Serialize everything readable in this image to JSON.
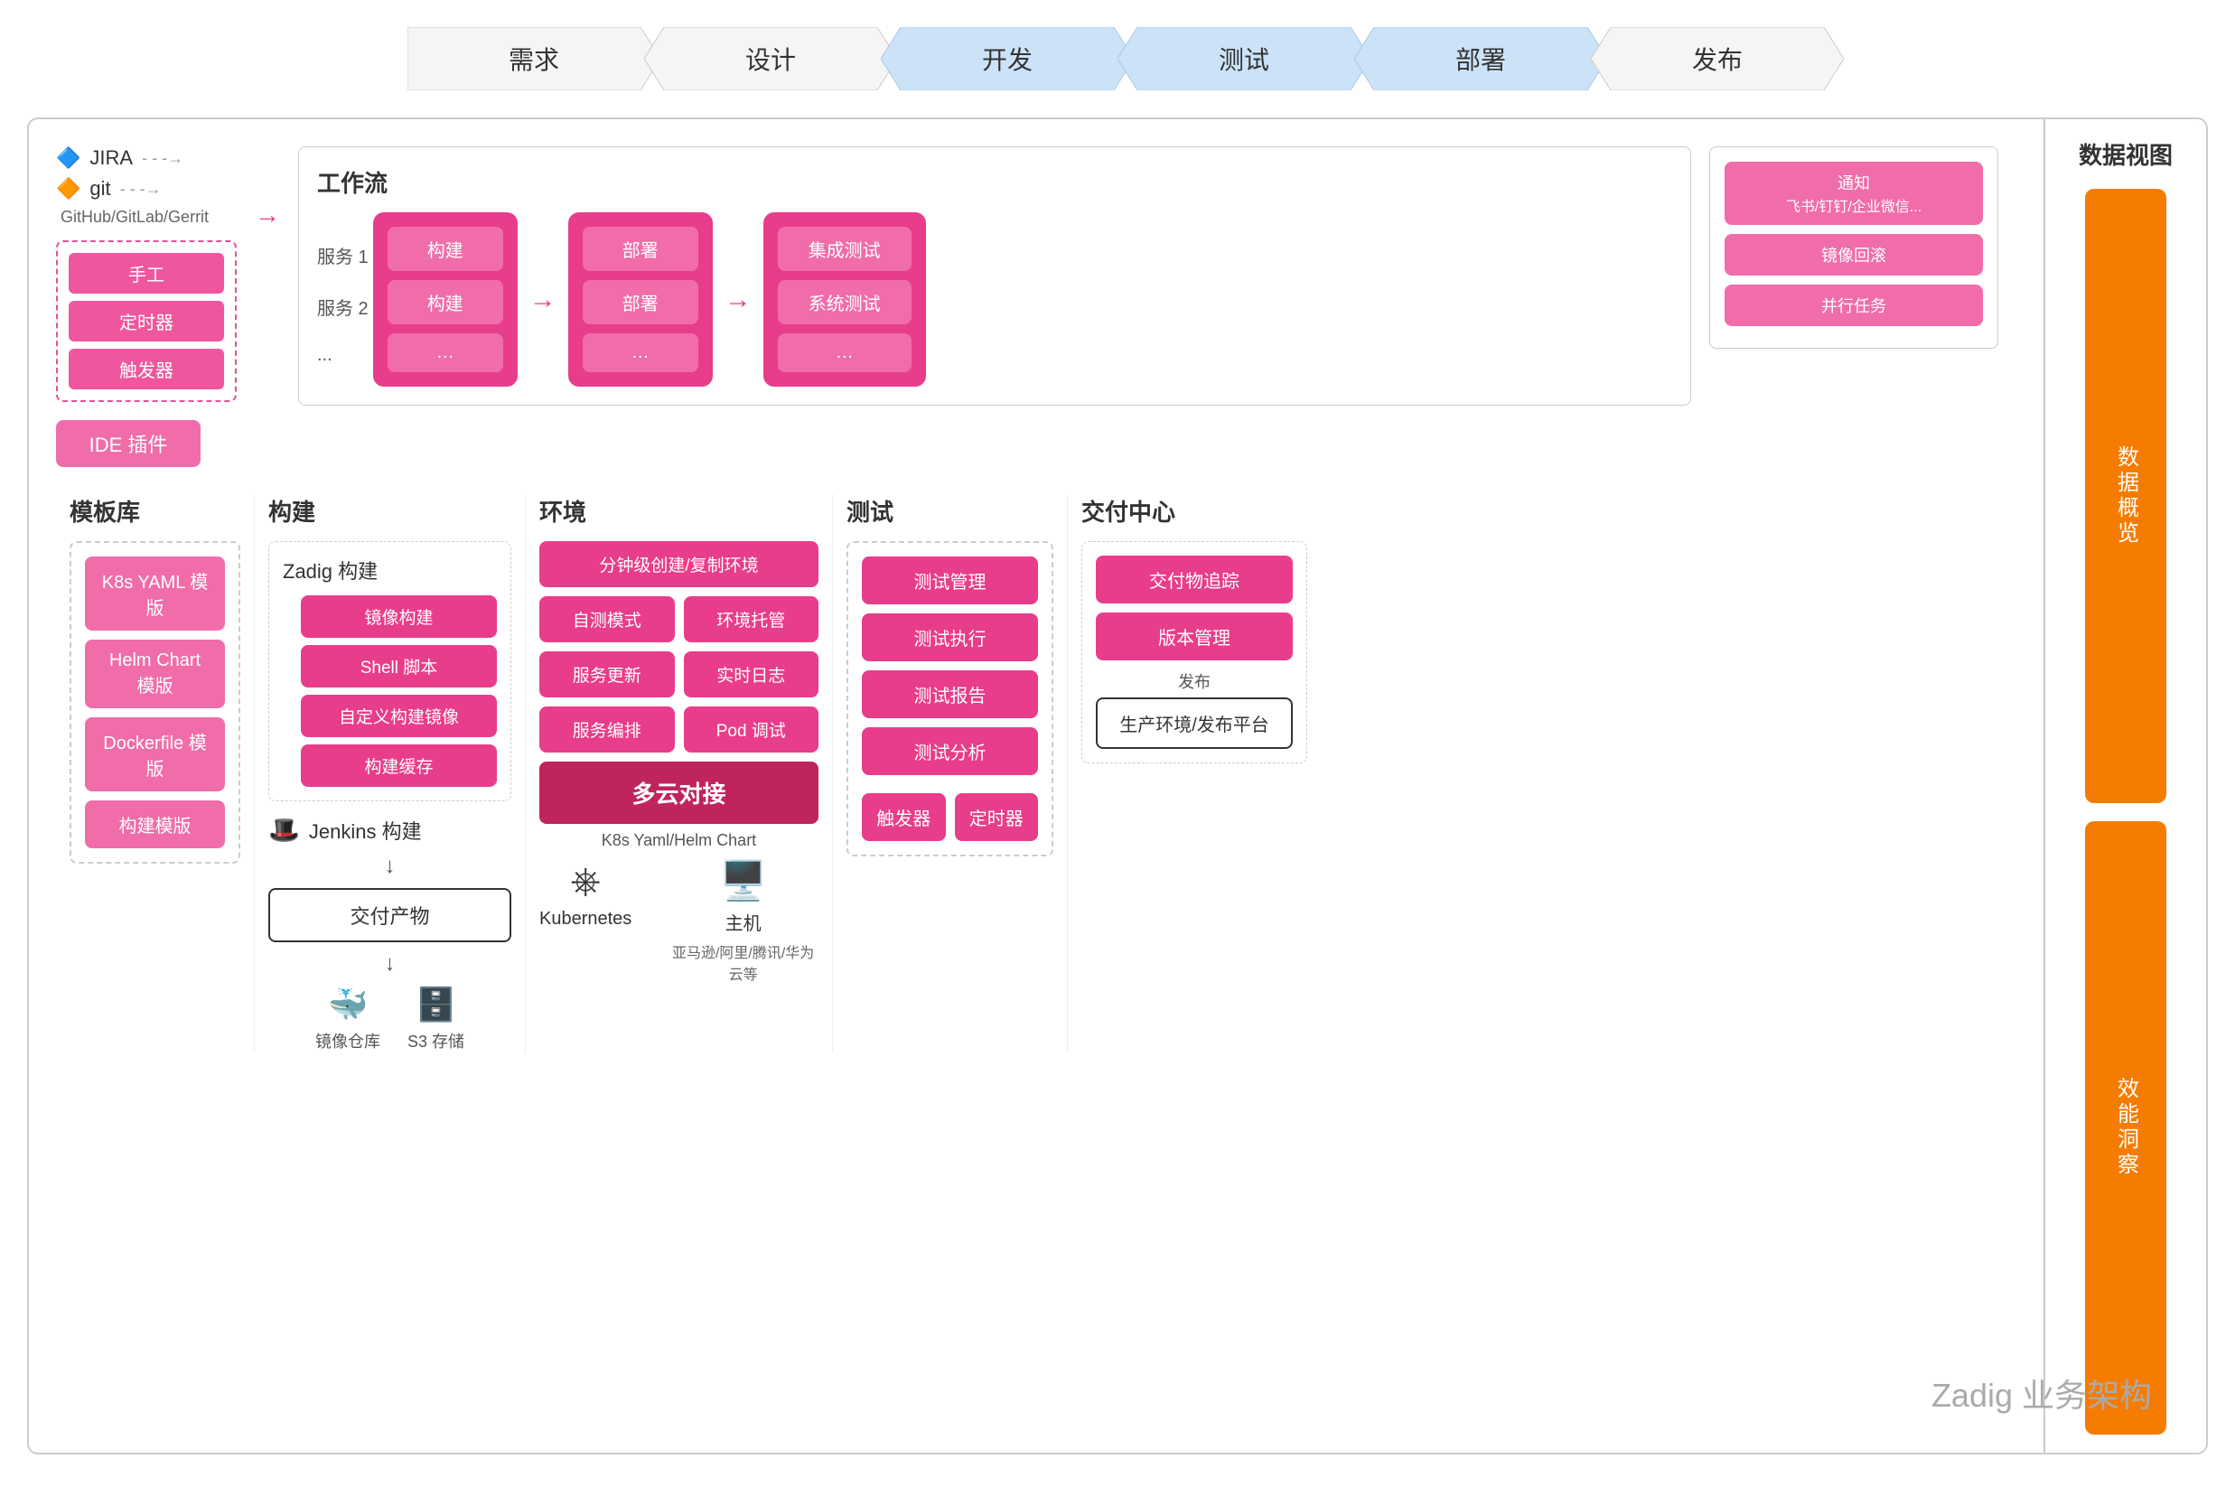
{
  "pipeline": {
    "steps": [
      {
        "label": "需求",
        "active": false
      },
      {
        "label": "设计",
        "active": false
      },
      {
        "label": "开发",
        "active": true
      },
      {
        "label": "测试",
        "active": true
      },
      {
        "label": "部署",
        "active": true
      },
      {
        "label": "发布",
        "active": false
      }
    ]
  },
  "source": {
    "jira_label": "JIRA",
    "git_label": "git",
    "github_label": "GitHub/GitLab/Gerrit",
    "manual": "手工",
    "timer": "定时器",
    "trigger": "触发器",
    "ide_plugin": "IDE 插件"
  },
  "workflow": {
    "title": "工作流",
    "service1": "服务 1",
    "service2": "服务 2",
    "dots": "...",
    "build_items": [
      "构建",
      "构建",
      "..."
    ],
    "deploy_items": [
      "部署",
      "部署",
      "..."
    ],
    "test_items": [
      "集成测试",
      "系统测试",
      "..."
    ]
  },
  "notifications": {
    "title": "通知",
    "subtitle": "飞书/钉钉/企业微信...",
    "rollback": "镜像回滚",
    "parallel": "并行任务"
  },
  "data_view": {
    "title": "数据视图",
    "overview": "数据概览",
    "insight": "效能洞察"
  },
  "template_lib": {
    "title": "模板库",
    "items": [
      "K8s YAML 模版",
      "Helm Chart 模版",
      "Dockerfile 模版",
      "构建模版"
    ]
  },
  "build": {
    "title": "构建",
    "zadig_title": "Zadig 构建",
    "zadig_items": [
      "镜像构建",
      "Shell 脚本",
      "自定义构建镜像",
      "构建缓存"
    ],
    "jenkins_title": "Jenkins 构建",
    "delivery_artifact": "交付产物",
    "image_repo": "镜像仓库",
    "s3_storage": "S3 存储"
  },
  "environment": {
    "title": "环境",
    "minute_create": "分钟级创建/复制环境",
    "self_test": "自测模式",
    "env_managed": "环境托管",
    "service_update": "服务更新",
    "realtime_log": "实时日志",
    "service_orchestration": "服务编排",
    "pod_debug": "Pod 调试",
    "multi_cloud": "多云对接",
    "k8s_yaml": "K8s Yaml/Helm Chart",
    "kubernetes": "Kubernetes",
    "host": "主机",
    "host_sub": "亚马逊/阿里/腾讯/华为云等"
  },
  "test": {
    "title": "测试",
    "items": [
      "测试管理",
      "测试执行",
      "测试报告",
      "测试分析"
    ],
    "trigger": "触发器",
    "timer": "定时器"
  },
  "delivery_center": {
    "title": "交付中心",
    "items": [
      "交付物追踪",
      "版本管理"
    ],
    "publish": "发布",
    "production": "生产环境/发布平台"
  },
  "watermark": "Zadig 业务架构"
}
